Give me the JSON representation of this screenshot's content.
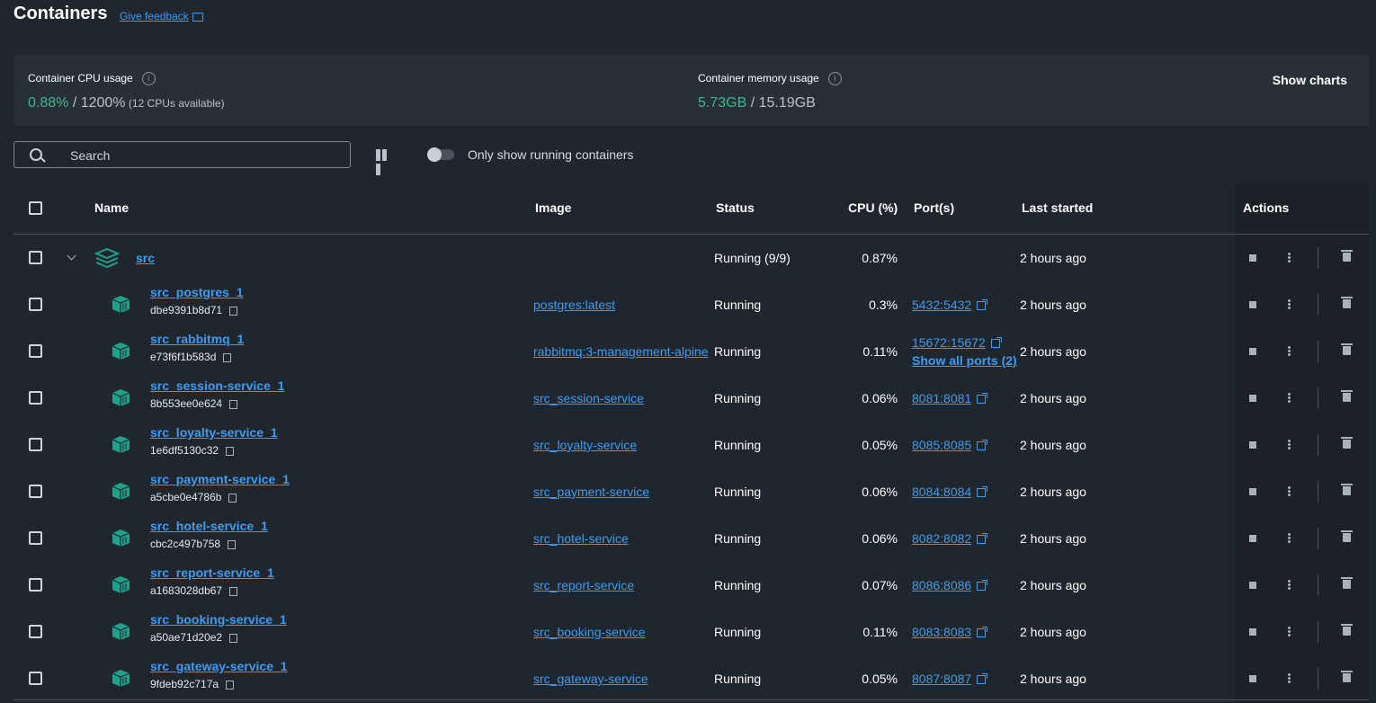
{
  "header": {
    "title": "Containers",
    "feedback": "Give feedback"
  },
  "stats": {
    "cpu_label": "Container CPU usage",
    "cpu_used": "0.88%",
    "cpu_total": " / 1200%",
    "cpu_note": " (12 CPUs available)",
    "mem_label": "Container memory usage",
    "mem_used": "5.73GB",
    "mem_total": " / 15.19GB",
    "show_charts": "Show charts"
  },
  "toolbar": {
    "search_placeholder": "Search",
    "toggle_label": "Only show running containers",
    "toggle_on": false
  },
  "table": {
    "headers": {
      "name": "Name",
      "image": "Image",
      "status": "Status",
      "cpu": "CPU (%)",
      "ports": "Port(s)",
      "last_started": "Last started",
      "actions": "Actions"
    },
    "group": {
      "name": "src",
      "status": "Running (9/9)",
      "cpu": "0.87%",
      "last_started": "2 hours ago"
    },
    "rows": [
      {
        "name": "src_postgres_1",
        "id": "dbe9391b8d71",
        "image": "postgres:latest",
        "status": "Running",
        "cpu": "0.3%",
        "port": "5432:5432",
        "last_started": "2 hours ago"
      },
      {
        "name": "src_rabbitmq_1",
        "id": "e73f6f1b583d",
        "image": "rabbitmq:3-management-alpine",
        "status": "Running",
        "cpu": "0.11%",
        "port": "15672:15672",
        "extra_ports": "Show all ports (2)",
        "last_started": "2 hours ago"
      },
      {
        "name": "src_session-service_1",
        "id": "8b553ee0e624",
        "image": "src_session-service",
        "status": "Running",
        "cpu": "0.06%",
        "port": "8081:8081",
        "last_started": "2 hours ago"
      },
      {
        "name": "src_loyalty-service_1",
        "id": "1e6df5130c32",
        "image": "src_loyalty-service",
        "status": "Running",
        "cpu": "0.05%",
        "port": "8085:8085",
        "last_started": "2 hours ago"
      },
      {
        "name": "src_payment-service_1",
        "id": "a5cbe0e4786b",
        "image": "src_payment-service",
        "status": "Running",
        "cpu": "0.06%",
        "port": "8084:8084",
        "last_started": "2 hours ago"
      },
      {
        "name": "src_hotel-service_1",
        "id": "cbc2c497b758",
        "image": "src_hotel-service",
        "status": "Running",
        "cpu": "0.06%",
        "port": "8082:8082",
        "last_started": "2 hours ago"
      },
      {
        "name": "src_report-service_1",
        "id": "a1683028db67",
        "image": "src_report-service",
        "status": "Running",
        "cpu": "0.07%",
        "port": "8086:8086",
        "last_started": "2 hours ago"
      },
      {
        "name": "src_booking-service_1",
        "id": "a50ae71d20e2",
        "image": "src_booking-service",
        "status": "Running",
        "cpu": "0.11%",
        "port": "8083:8083",
        "last_started": "2 hours ago"
      },
      {
        "name": "src_gateway-service_1",
        "id": "9fdeb92c717a",
        "image": "src_gateway-service",
        "status": "Running",
        "cpu": "0.05%",
        "port": "8087:8087",
        "last_started": "2 hours ago"
      }
    ]
  },
  "colors": {
    "accent": "#3d9cf0",
    "green": "#3fb68b",
    "teal_icon": "#1fa08a",
    "background": "#1f262d"
  }
}
